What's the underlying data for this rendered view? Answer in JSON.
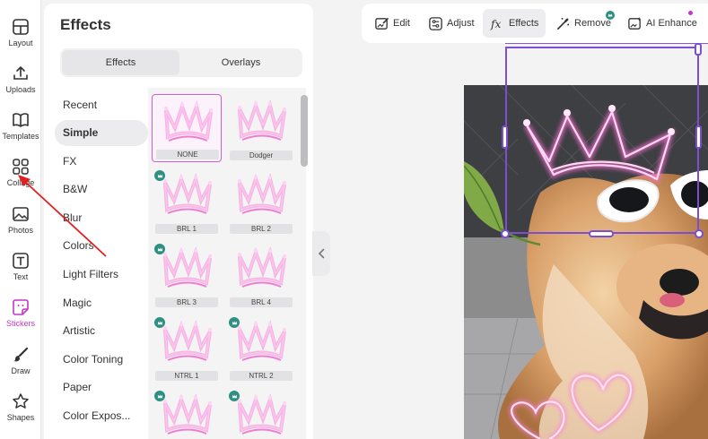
{
  "rail": {
    "items": [
      {
        "label": "Layout",
        "icon": "layout-icon"
      },
      {
        "label": "Uploads",
        "icon": "upload-icon"
      },
      {
        "label": "Templates",
        "icon": "templates-icon"
      },
      {
        "label": "Collage",
        "icon": "collage-icon"
      },
      {
        "label": "Photos",
        "icon": "photos-icon"
      },
      {
        "label": "Text",
        "icon": "text-icon"
      },
      {
        "label": "Stickers",
        "icon": "stickers-icon",
        "active": true
      },
      {
        "label": "Draw",
        "icon": "brush-icon"
      },
      {
        "label": "Shapes",
        "icon": "shapes-icon"
      }
    ]
  },
  "panel": {
    "title": "Effects",
    "tabs": {
      "effects": "Effects",
      "overlays": "Overlays"
    },
    "categories": [
      "Recent",
      "Simple",
      "FX",
      "B&W",
      "Blur",
      "Colors",
      "Light Filters",
      "Magic",
      "Artistic",
      "Color Toning",
      "Paper",
      "Color Expos..."
    ],
    "active_category": "Simple",
    "tiles": [
      {
        "name": "NONE",
        "selected": true,
        "badge": false
      },
      {
        "name": "Dodger",
        "badge": false
      },
      {
        "name": "BRL 1",
        "badge": true
      },
      {
        "name": "BRL 2",
        "badge": false
      },
      {
        "name": "BRL 3",
        "badge": true
      },
      {
        "name": "BRL 4",
        "badge": false
      },
      {
        "name": "NTRL 1",
        "badge": true
      },
      {
        "name": "NTRL 2",
        "badge": true
      },
      {
        "name": "",
        "badge": true
      },
      {
        "name": "",
        "badge": true
      }
    ]
  },
  "toolbar": {
    "edit": "Edit",
    "adjust": "Adjust",
    "effects": "Effects",
    "remove": "Remove",
    "ai_enhance": "AI Enhance",
    "active": "Effects"
  },
  "colors": {
    "accent": "#c437c9",
    "premium_badge": "#2e8f83",
    "selection": "#7b4fd0",
    "annotation_arrow": "#e02020"
  }
}
